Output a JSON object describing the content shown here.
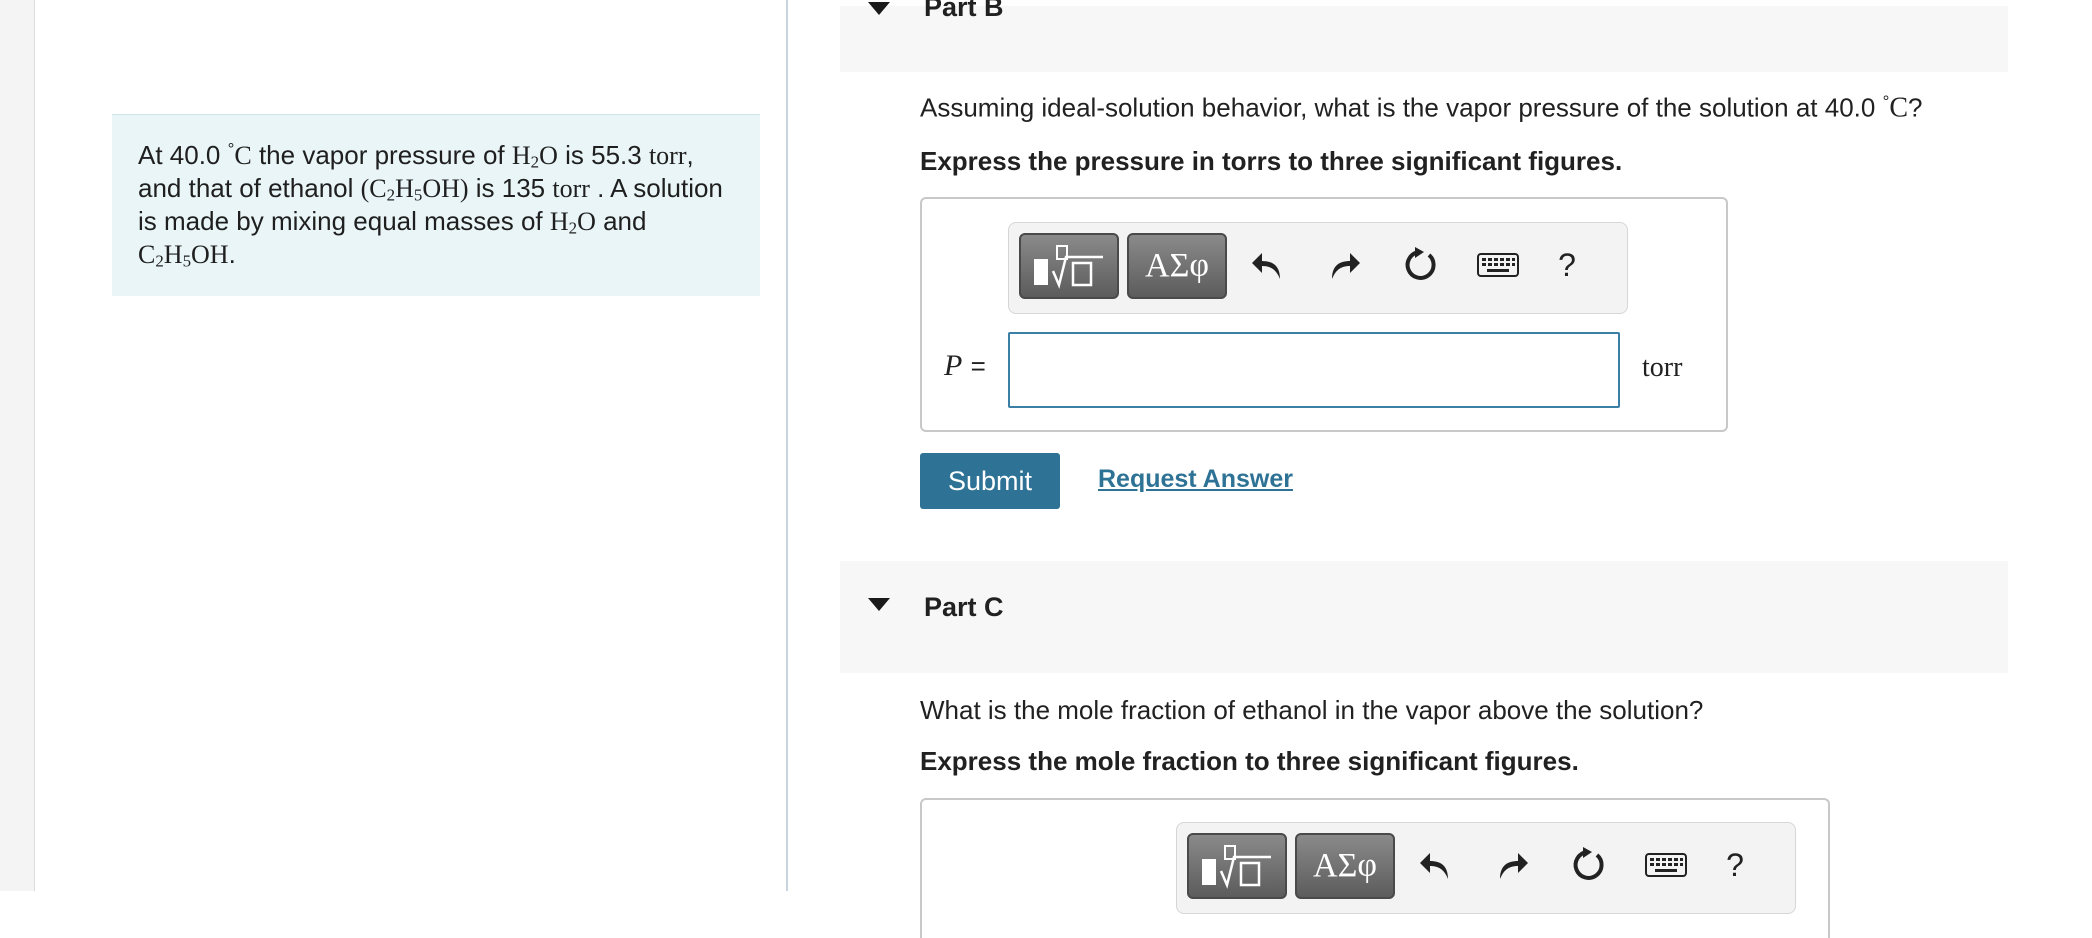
{
  "intro": {
    "t1": "At 40.0 ",
    "deg1": "°",
    "c1": "C",
    "t2": " the vapor pressure of ",
    "h": "H",
    "h2sub": "2",
    "o": "O",
    "t3": " is 55.3 ",
    "torr1": "torr",
    "t4": ", and that of ethanol ",
    "eth_open": "(C",
    "eth_c_sub": "2",
    "eth_h": "H",
    "eth_h_sub": "5",
    "eth_close": "OH)",
    "t5": " is 135 ",
    "torr2": "torr",
    "t6": " . A solution is made by mixing equal masses of ",
    "h2o_h": "H",
    "h2o_sub": "2",
    "h2o_o": "O",
    "t7": " and ",
    "c2_c": "C",
    "c2_sub": "2",
    "c2_h": "H",
    "c2_h_sub": "5",
    "c2_oh": "OH",
    "t8": "."
  },
  "partB": {
    "title": "Part B",
    "question_pre": "Assuming ideal-solution behavior, what is the vapor pressure of the solution at 40.0 ",
    "question_deg": "°",
    "question_unit": "C",
    "question_end": "?",
    "instruction": "Express the pressure in torrs to three significant figures.",
    "var_label": "P",
    "equals": "=",
    "input_value": "",
    "unit": "torr"
  },
  "toolbar": {
    "greek_label": "ΑΣφ",
    "help_label": "?"
  },
  "actions": {
    "submit_label": "Submit",
    "request_label": "Request Answer"
  },
  "partC": {
    "title": "Part C",
    "question": "What is the mole fraction of ethanol in the vapor above the solution?",
    "instruction": "Express the mole fraction to three significant figures."
  },
  "colors": {
    "accent": "#2e7396",
    "intro_bg": "#e9f5f7",
    "part_bar_bg": "#f7f7f7"
  }
}
